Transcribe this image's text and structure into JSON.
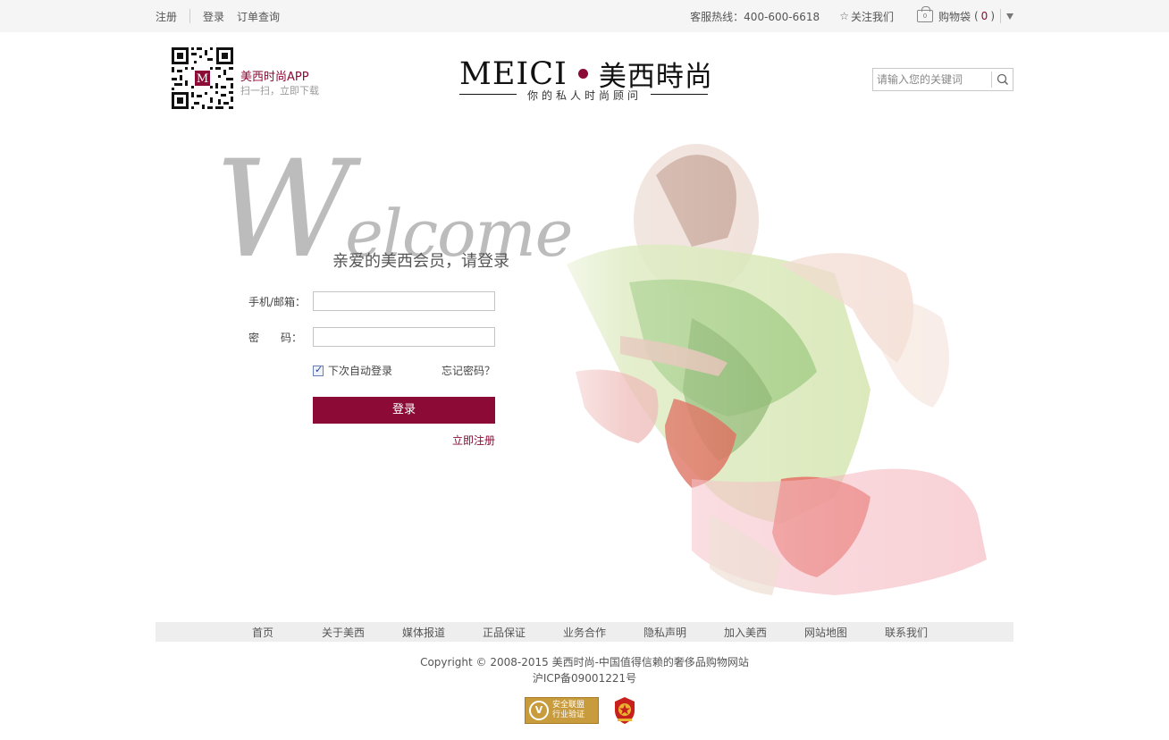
{
  "topbar": {
    "register": "注册",
    "login": "登录",
    "order_query": "订单查询",
    "hotline": "客服热线：400-600-6618",
    "follow": "关注我们",
    "cart_label": "购物袋",
    "cart_open": "(",
    "cart_count": "0",
    "cart_close": ")",
    "bag_count": "0"
  },
  "header": {
    "app_title": "美西时尚APP",
    "app_subtitle": "扫一扫，立即下载",
    "logo_en": "MEICI",
    "logo_cn": "美西時尚",
    "logo_tagline": "你的私人时尚顾问",
    "search_placeholder": "请输入您的关键词"
  },
  "login": {
    "welcome_big": "W",
    "welcome_rest": "elcome",
    "greeting": "亲爱的美西会员，请登录",
    "account_label": "手机/邮箱：",
    "password_label": "密　　码：",
    "account_value": "",
    "password_value": "",
    "remember_label": "下次自动登录",
    "remember_checked": true,
    "forgot_label": "忘记密码？",
    "submit_label": "登录",
    "register_label": "立即注册"
  },
  "footer": {
    "nav": [
      "首页",
      "关于美西",
      "媒体报道",
      "正品保证",
      "业务合作",
      "隐私声明",
      "加入美西",
      "网站地图",
      "联系我们"
    ],
    "copyright": "Copyright © 2008-2015 美西时尚-中国值得信赖的奢侈品购物网站",
    "icp": "沪ICP备09001221号",
    "badge_line1": "安全联盟",
    "badge_line2": "行业验证",
    "badge_letter": "V"
  },
  "colors": {
    "brand": "#8c0b36",
    "topbar_bg": "#f5f5f5",
    "footnav_bg": "#eeeeee"
  },
  "icons": [
    "star-icon",
    "shopping-bag-icon",
    "dropdown-arrow-icon",
    "qr-code-icon",
    "search-icon",
    "security-badge-icon",
    "police-emblem-icon"
  ]
}
